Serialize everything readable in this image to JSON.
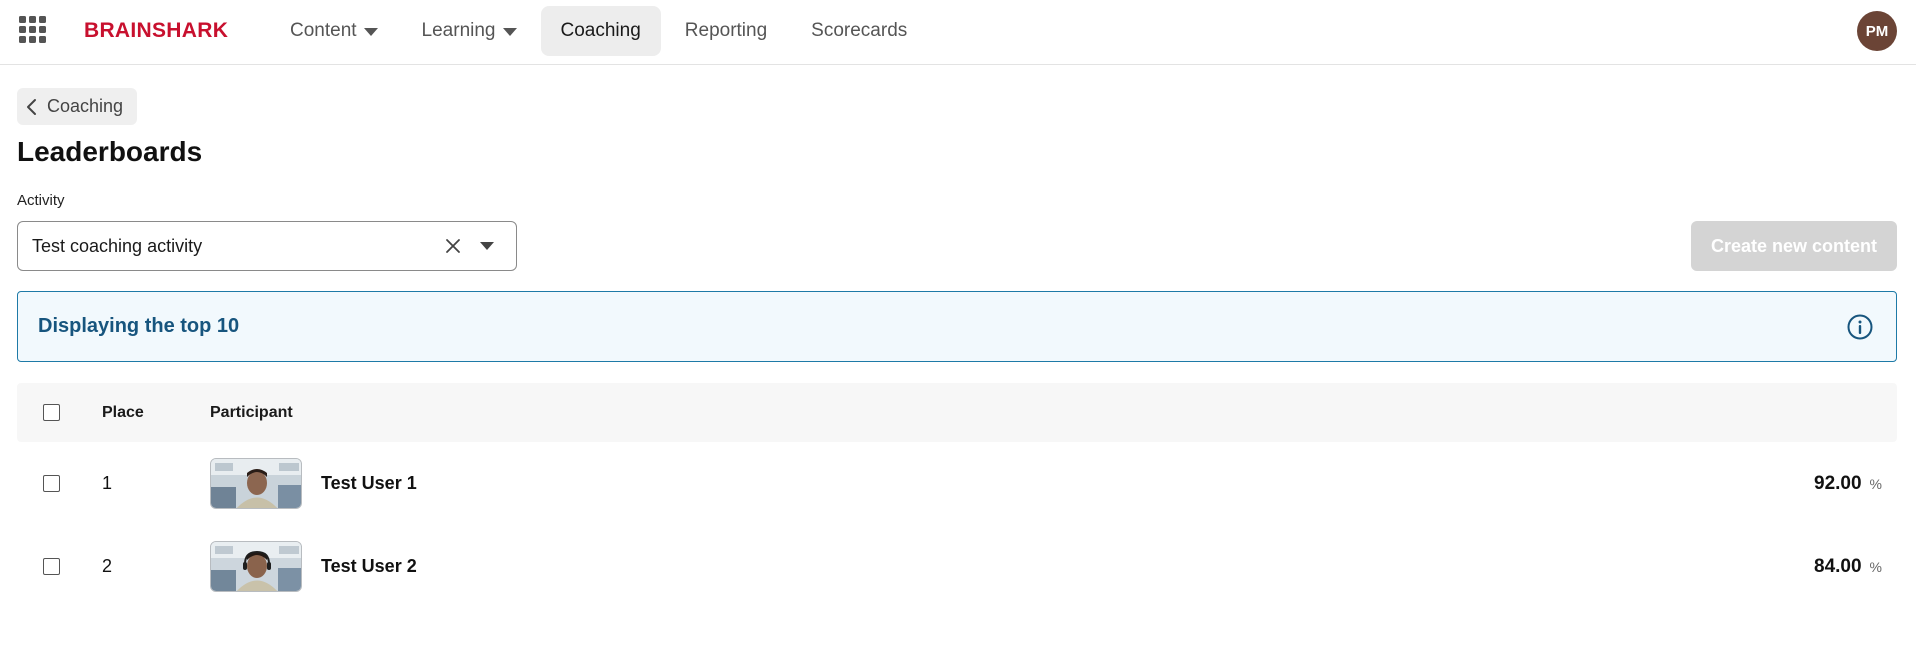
{
  "brand": {
    "logo_text": "BRAINSHARK"
  },
  "nav": {
    "items": [
      {
        "label": "Content",
        "has_dropdown": true,
        "active": false
      },
      {
        "label": "Learning",
        "has_dropdown": true,
        "active": false
      },
      {
        "label": "Coaching",
        "has_dropdown": false,
        "active": true
      },
      {
        "label": "Reporting",
        "has_dropdown": false,
        "active": false
      },
      {
        "label": "Scorecards",
        "has_dropdown": false,
        "active": false
      }
    ]
  },
  "user": {
    "initials": "PM",
    "avatar_color": "#6b4436"
  },
  "breadcrumb": {
    "back_label": "Coaching"
  },
  "page": {
    "title": "Leaderboards"
  },
  "activity": {
    "label": "Activity",
    "selected_value": "Test coaching activity"
  },
  "actions": {
    "create_label": "Create new content",
    "create_disabled": true
  },
  "banner": {
    "text": "Displaying the top 10"
  },
  "table": {
    "headers": {
      "place": "Place",
      "participant": "Participant"
    },
    "rows": [
      {
        "place": "1",
        "name": "Test User 1",
        "score": "92.00",
        "unit": "%"
      },
      {
        "place": "2",
        "name": "Test User 2",
        "score": "84.00",
        "unit": "%"
      }
    ]
  },
  "colors": {
    "brand_red": "#c8102e",
    "banner_border": "#1e7aa7",
    "banner_bg": "#f2f9fd",
    "banner_text": "#17557e",
    "button_disabled": "#d4d4d4"
  }
}
